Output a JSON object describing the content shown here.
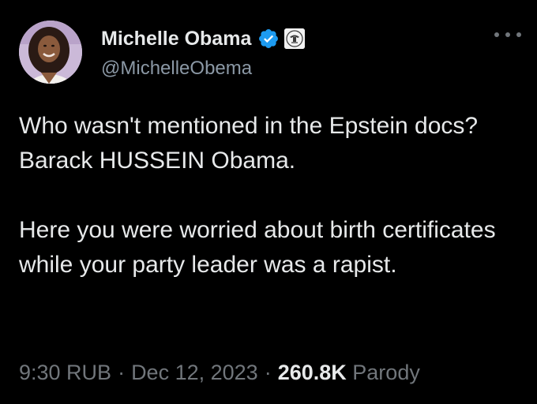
{
  "tweet": {
    "author": {
      "display_name": "Michelle Obama",
      "handle": "@MichelleObema",
      "verified_icon": "verified-badge-icon",
      "affiliation_icon": "government-seal-icon"
    },
    "body": {
      "paragraph_1": "Who wasn't mentioned in the Epstein docs? Barack HUSSEIN Obama.",
      "paragraph_2": "Here you were worried about birth certificates while your party leader was a rapist."
    },
    "meta": {
      "time": "9:30 RUB",
      "separator": "·",
      "date": "Dec 12, 2023",
      "views": "260.8K",
      "label": "Parody"
    },
    "more_icon": "more-options-icon"
  },
  "colors": {
    "background": "#000000",
    "primary_text": "#e7e9ea",
    "secondary_text": "#71767b",
    "verified_blue": "#1d9bf0"
  }
}
